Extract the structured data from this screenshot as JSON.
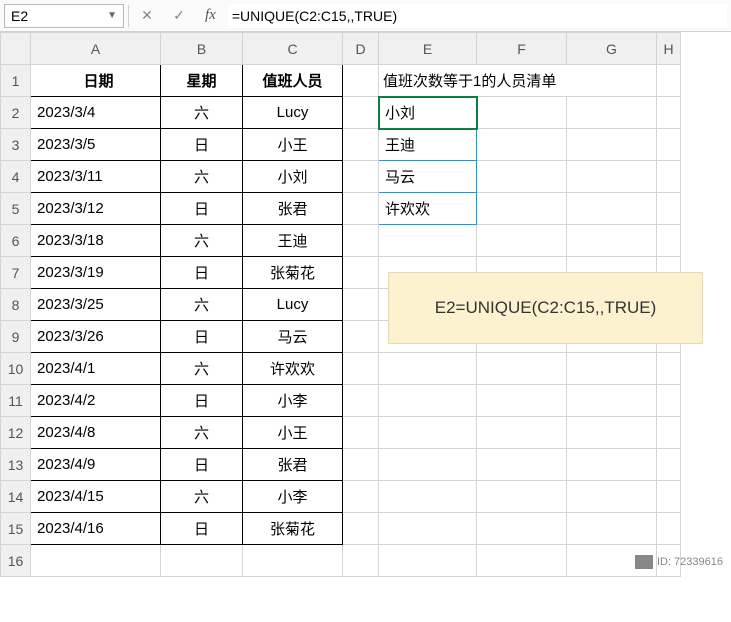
{
  "namebox": "E2",
  "formula": "=UNIQUE(C2:C15,,TRUE)",
  "col_headers": [
    "A",
    "B",
    "C",
    "D",
    "E",
    "F",
    "G",
    "H"
  ],
  "row_headers": [
    "1",
    "2",
    "3",
    "4",
    "5",
    "6",
    "7",
    "8",
    "9",
    "10",
    "11",
    "12",
    "13",
    "14",
    "15",
    "16"
  ],
  "table": {
    "h1": "日期",
    "h2": "星期",
    "h3": "值班人员",
    "rows": [
      {
        "a": "2023/3/4",
        "b": "六",
        "c": "Lucy"
      },
      {
        "a": "2023/3/5",
        "b": "日",
        "c": "小王"
      },
      {
        "a": "2023/3/11",
        "b": "六",
        "c": "小刘"
      },
      {
        "a": "2023/3/12",
        "b": "日",
        "c": "张君"
      },
      {
        "a": "2023/3/18",
        "b": "六",
        "c": "王迪"
      },
      {
        "a": "2023/3/19",
        "b": "日",
        "c": "张菊花"
      },
      {
        "a": "2023/3/25",
        "b": "六",
        "c": "Lucy"
      },
      {
        "a": "2023/3/26",
        "b": "日",
        "c": "马云"
      },
      {
        "a": "2023/4/1",
        "b": "六",
        "c": "许欢欢"
      },
      {
        "a": "2023/4/2",
        "b": "日",
        "c": "小李"
      },
      {
        "a": "2023/4/8",
        "b": "六",
        "c": "小王"
      },
      {
        "a": "2023/4/9",
        "b": "日",
        "c": "张君"
      },
      {
        "a": "2023/4/15",
        "b": "六",
        "c": "小李"
      },
      {
        "a": "2023/4/16",
        "b": "日",
        "c": "张菊花"
      }
    ]
  },
  "side": {
    "title": "值班次数等于1的人员清单",
    "items": [
      "小刘",
      "王迪",
      "马云",
      "许欢欢"
    ]
  },
  "note": "E2=UNIQUE(C2:C15,,TRUE)",
  "watermark": "ID: 72339616"
}
